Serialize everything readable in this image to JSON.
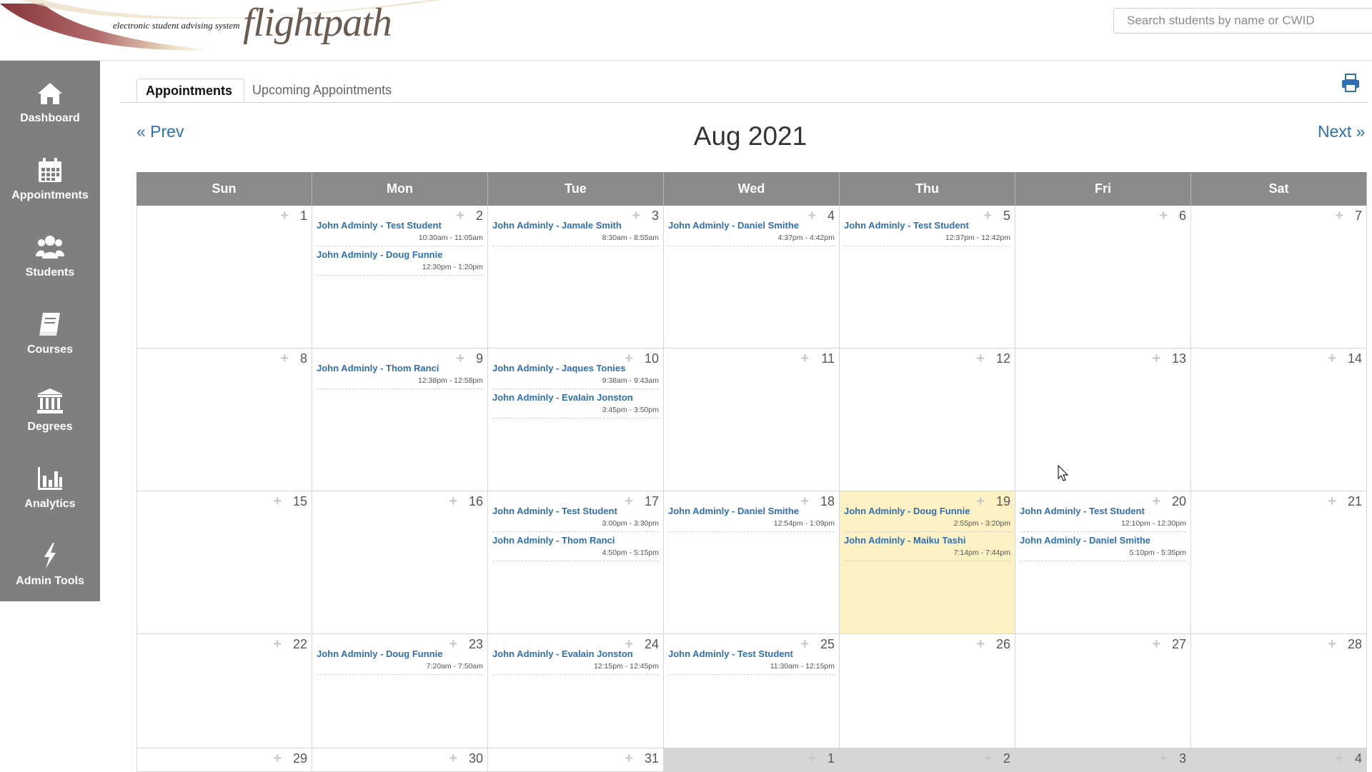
{
  "header": {
    "logo_tagline": "electronic student advising system",
    "logo_brand": "flightpath",
    "search_placeholder": "Search students by name or CWID"
  },
  "sidebar": {
    "items": [
      {
        "label": "Dashboard",
        "icon": "home-icon"
      },
      {
        "label": "Appointments",
        "icon": "calendar-icon"
      },
      {
        "label": "Students",
        "icon": "users-icon"
      },
      {
        "label": "Courses",
        "icon": "book-icon"
      },
      {
        "label": "Degrees",
        "icon": "institution-icon"
      },
      {
        "label": "Analytics",
        "icon": "bar-chart-icon"
      },
      {
        "label": "Admin Tools",
        "icon": "lightning-bolt-icon"
      }
    ]
  },
  "tabs": {
    "active": "Appointments",
    "other": "Upcoming Appointments"
  },
  "calendar": {
    "prev_label": "« Prev",
    "next_label": "Next »",
    "month_label": "Aug 2021",
    "weekdays": [
      "Sun",
      "Mon",
      "Tue",
      "Wed",
      "Thu",
      "Fri",
      "Sat"
    ],
    "colors": {
      "accent_link": "#2f6fb3",
      "today_bg": "#fbf1c2",
      "header_bg": "#8a8a8a",
      "sidebar_bg": "#7f7f7f"
    },
    "weeks": [
      [
        {
          "day": "1",
          "appts": []
        },
        {
          "day": "2",
          "appts": [
            {
              "title": "John Adminly - Test Student",
              "time": "10:30am - 11:05am"
            },
            {
              "title": "John Adminly - Doug Funnie",
              "time": "12:30pm - 1:20pm"
            }
          ]
        },
        {
          "day": "3",
          "appts": [
            {
              "title": "John Adminly - Jamale Smith",
              "time": "8:30am - 8:55am"
            }
          ]
        },
        {
          "day": "4",
          "appts": [
            {
              "title": "John Adminly - Daniel Smithe",
              "time": "4:37pm - 4:42pm"
            }
          ]
        },
        {
          "day": "5",
          "appts": [
            {
              "title": "John Adminly - Test Student",
              "time": "12:37pm - 12:42pm"
            }
          ]
        },
        {
          "day": "6",
          "appts": []
        },
        {
          "day": "7",
          "appts": []
        }
      ],
      [
        {
          "day": "8",
          "appts": []
        },
        {
          "day": "9",
          "appts": [
            {
              "title": "John Adminly - Thom Ranci",
              "time": "12:38pm - 12:58pm"
            }
          ]
        },
        {
          "day": "10",
          "appts": [
            {
              "title": "John Adminly - Jaques Tonies",
              "time": "9:38am - 9:43am"
            },
            {
              "title": "John Adminly - Evalain Jonston",
              "time": "3:45pm - 3:50pm"
            }
          ]
        },
        {
          "day": "11",
          "appts": []
        },
        {
          "day": "12",
          "appts": []
        },
        {
          "day": "13",
          "appts": []
        },
        {
          "day": "14",
          "appts": []
        }
      ],
      [
        {
          "day": "15",
          "appts": []
        },
        {
          "day": "16",
          "appts": []
        },
        {
          "day": "17",
          "appts": [
            {
              "title": "John Adminly - Test Student",
              "time": "3:00pm - 3:30pm"
            },
            {
              "title": "John Adminly - Thom Ranci",
              "time": "4:50pm - 5:15pm"
            }
          ]
        },
        {
          "day": "18",
          "appts": [
            {
              "title": "John Adminly - Daniel Smithe",
              "time": "12:54pm - 1:09pm"
            }
          ]
        },
        {
          "day": "19",
          "today": true,
          "appts": [
            {
              "title": "John Adminly - Doug Funnie",
              "time": "2:55pm - 3:20pm"
            },
            {
              "title": "John Adminly - Maiku Tashi",
              "time": "7:14pm - 7:44pm"
            }
          ]
        },
        {
          "day": "20",
          "appts": [
            {
              "title": "John Adminly - Test Student",
              "time": "12:10pm - 12:30pm"
            },
            {
              "title": "John Adminly - Daniel Smithe",
              "time": "5:10pm - 5:35pm"
            }
          ]
        },
        {
          "day": "21",
          "appts": []
        }
      ],
      [
        {
          "day": "22",
          "appts": []
        },
        {
          "day": "23",
          "appts": [
            {
              "title": "John Adminly - Doug Funnie",
              "time": "7:20am - 7:50am"
            }
          ]
        },
        {
          "day": "24",
          "appts": [
            {
              "title": "John Adminly - Evalain Jonston",
              "time": "12:15pm - 12:45pm"
            }
          ]
        },
        {
          "day": "25",
          "appts": [
            {
              "title": "John Adminly - Test Student",
              "time": "11:30am - 12:15pm"
            }
          ]
        },
        {
          "day": "26",
          "appts": []
        },
        {
          "day": "27",
          "appts": []
        },
        {
          "day": "28",
          "appts": []
        }
      ],
      [
        {
          "day": "29",
          "appts": []
        },
        {
          "day": "30",
          "appts": []
        },
        {
          "day": "31",
          "appts": []
        },
        {
          "day": "1",
          "other_month": true,
          "appts": []
        },
        {
          "day": "2",
          "other_month": true,
          "appts": []
        },
        {
          "day": "3",
          "other_month": true,
          "appts": []
        },
        {
          "day": "4",
          "other_month": true,
          "appts": []
        }
      ]
    ]
  }
}
